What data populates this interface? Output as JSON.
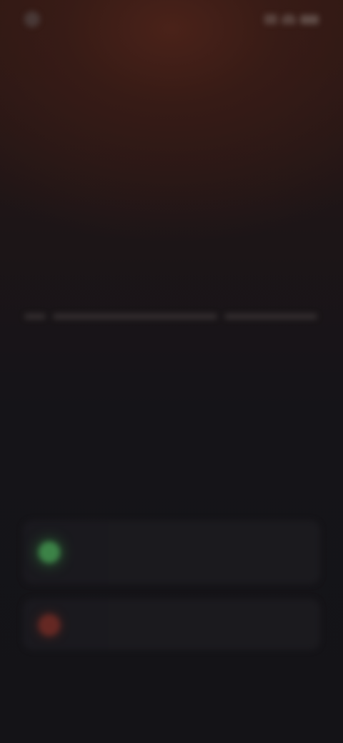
{
  "status_bar": {
    "time": "",
    "icons": [
      "signal-icon",
      "wifi-icon",
      "battery-icon"
    ]
  },
  "header": {
    "title": ""
  },
  "article": {
    "section_label": "",
    "headline": "",
    "body": "",
    "meta": ""
  },
  "cards": [
    {
      "status": "green-dot-icon",
      "label": "",
      "detail": ""
    },
    {
      "status": "red-dot-icon",
      "label": ""
    }
  ],
  "colors": {
    "background": "#141317",
    "accent_top": "#4a2219",
    "green_status": "#3f8a4a",
    "red_status": "#6a2a24"
  }
}
